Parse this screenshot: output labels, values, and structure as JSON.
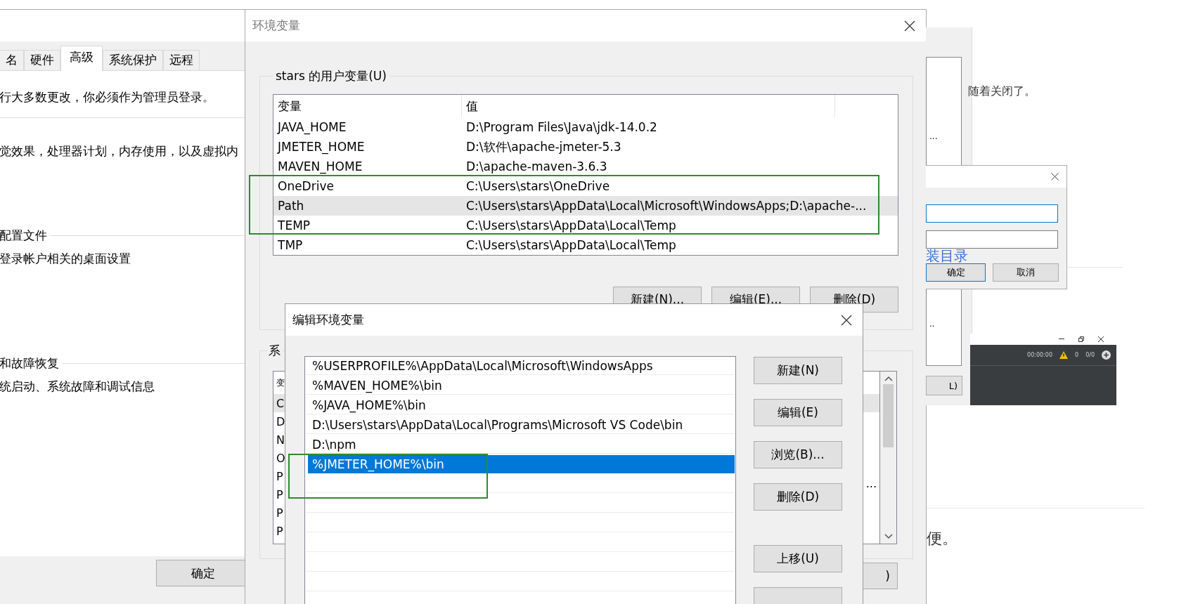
{
  "system_properties": {
    "tabs": [
      {
        "label": "名",
        "selected": false
      },
      {
        "label": "硬件",
        "selected": false
      },
      {
        "label": "高级",
        "selected": true
      },
      {
        "label": "系统保护",
        "selected": false
      },
      {
        "label": "远程",
        "selected": false
      }
    ],
    "notice": "行大多数更改，你必须作为管理员登录。",
    "sections": [
      {
        "description": "觉效果，处理器计划，内存使用，以及虚拟内"
      },
      {
        "title": "配置文件",
        "description": "登录帐户相关的桌面设置"
      },
      {
        "title": "和故障恢复",
        "description": "统启动、系统故障和调试信息"
      }
    ],
    "ok_button": "确定"
  },
  "environment_variables": {
    "title": "环境变量",
    "user_variables": {
      "label": "stars 的用户变量(U)",
      "columns": [
        "变量",
        "值"
      ],
      "rows": [
        {
          "name": "JAVA_HOME",
          "value": "D:\\Program Files\\Java\\jdk-14.0.2",
          "selected": false
        },
        {
          "name": "JMETER_HOME",
          "value": "D:\\软件\\apache-jmeter-5.3",
          "selected": false
        },
        {
          "name": "MAVEN_HOME",
          "value": "D:\\apache-maven-3.6.3",
          "selected": false
        },
        {
          "name": "OneDrive",
          "value": "C:\\Users\\stars\\OneDrive",
          "selected": false
        },
        {
          "name": "Path",
          "value": "C:\\Users\\stars\\AppData\\Local\\Microsoft\\WindowsApps;D:\\apache-...",
          "selected": true
        },
        {
          "name": "TEMP",
          "value": "C:\\Users\\stars\\AppData\\Local\\Temp",
          "selected": false
        },
        {
          "name": "TMP",
          "value": "C:\\Users\\stars\\AppData\\Local\\Temp",
          "selected": false
        }
      ],
      "buttons": [
        "新建(N)...",
        "编辑(E)...",
        "删除(D)"
      ]
    },
    "system_variables": {
      "label": "系",
      "header": "变",
      "rows": [
        {
          "name": "C",
          "selected": true
        },
        {
          "name": "D",
          "selected": false
        },
        {
          "name": "N",
          "selected": false
        },
        {
          "name": "O",
          "selected": false
        },
        {
          "name": "P",
          "selected": false
        },
        {
          "name": "P",
          "selected": false
        },
        {
          "name": "P",
          "selected": false
        },
        {
          "name": "P",
          "selected": false
        }
      ],
      "overflow": "..."
    },
    "bottom_button": ")"
  },
  "edit_variable": {
    "title": "编辑环境变量",
    "entries": [
      {
        "text": "%USERPROFILE%\\AppData\\Local\\Microsoft\\WindowsApps",
        "selected": false
      },
      {
        "text": "%MAVEN_HOME%\\bin",
        "selected": false
      },
      {
        "text": "%JAVA_HOME%\\bin",
        "selected": false
      },
      {
        "text": "D:\\Users\\stars\\AppData\\Local\\Programs\\Microsoft VS Code\\bin",
        "selected": false
      },
      {
        "text": "D:\\npm",
        "selected": false
      },
      {
        "text": "%JMETER_HOME%\\bin",
        "selected": true
      }
    ],
    "buttons": [
      "新建(N)",
      "编辑(E)",
      "浏览(B)...",
      "删除(D)",
      "上移(U)"
    ]
  },
  "blog": {
    "side_panel": {
      "fragments": [
        "...",
        ".."
      ],
      "button": "L)"
    },
    "text_top": "随着关闭了。",
    "dialog": {
      "link": "装目录",
      "ok": "确定",
      "cancel": "取消"
    },
    "player": {
      "time": "00:00:00",
      "warnings": "0",
      "count": "0/0"
    },
    "text_bottom": "便。"
  }
}
